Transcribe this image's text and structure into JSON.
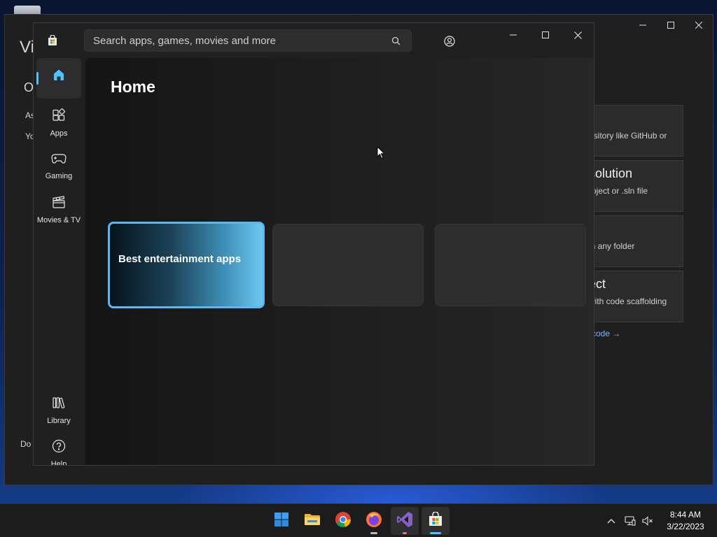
{
  "background_window": {
    "app": "Visual Studio",
    "fragments": {
      "title": "Vi",
      "heading": "O",
      "line1": "As",
      "line2": "Yo",
      "bottom": "Do"
    },
    "cards": [
      {
        "title": "",
        "subtitle": "ository like GitHub or"
      },
      {
        "title": "solution",
        "subtitle": "roject or .sln file"
      },
      {
        "title": "r",
        "subtitle": "in any folder"
      },
      {
        "title": "ect",
        "subtitle": "with code scaffolding"
      }
    ],
    "link": "code →"
  },
  "store": {
    "search": {
      "placeholder": "Search apps, games, movies and more"
    },
    "nav": [
      {
        "label": "",
        "icon": "home-icon",
        "active": true
      },
      {
        "label": "Apps",
        "icon": "apps-icon"
      },
      {
        "label": "Gaming",
        "icon": "gamepad-icon"
      },
      {
        "label": "Movies & TV",
        "icon": "clapperboard-icon"
      },
      {
        "label": "Library",
        "icon": "library-icon"
      },
      {
        "label": "Help",
        "icon": "help-icon"
      }
    ],
    "page_title": "Home",
    "featured_card": "Best entertainment apps"
  },
  "taskbar": {
    "apps": [
      "start",
      "file-explorer",
      "chrome",
      "firefox",
      "visual-studio",
      "microsoft-store"
    ],
    "time": "8:44 AM",
    "date": "3/22/2023"
  },
  "colors": {
    "accent": "#4cc2ff",
    "store_bg": "#202020",
    "taskbar": "#1c1c1c"
  }
}
